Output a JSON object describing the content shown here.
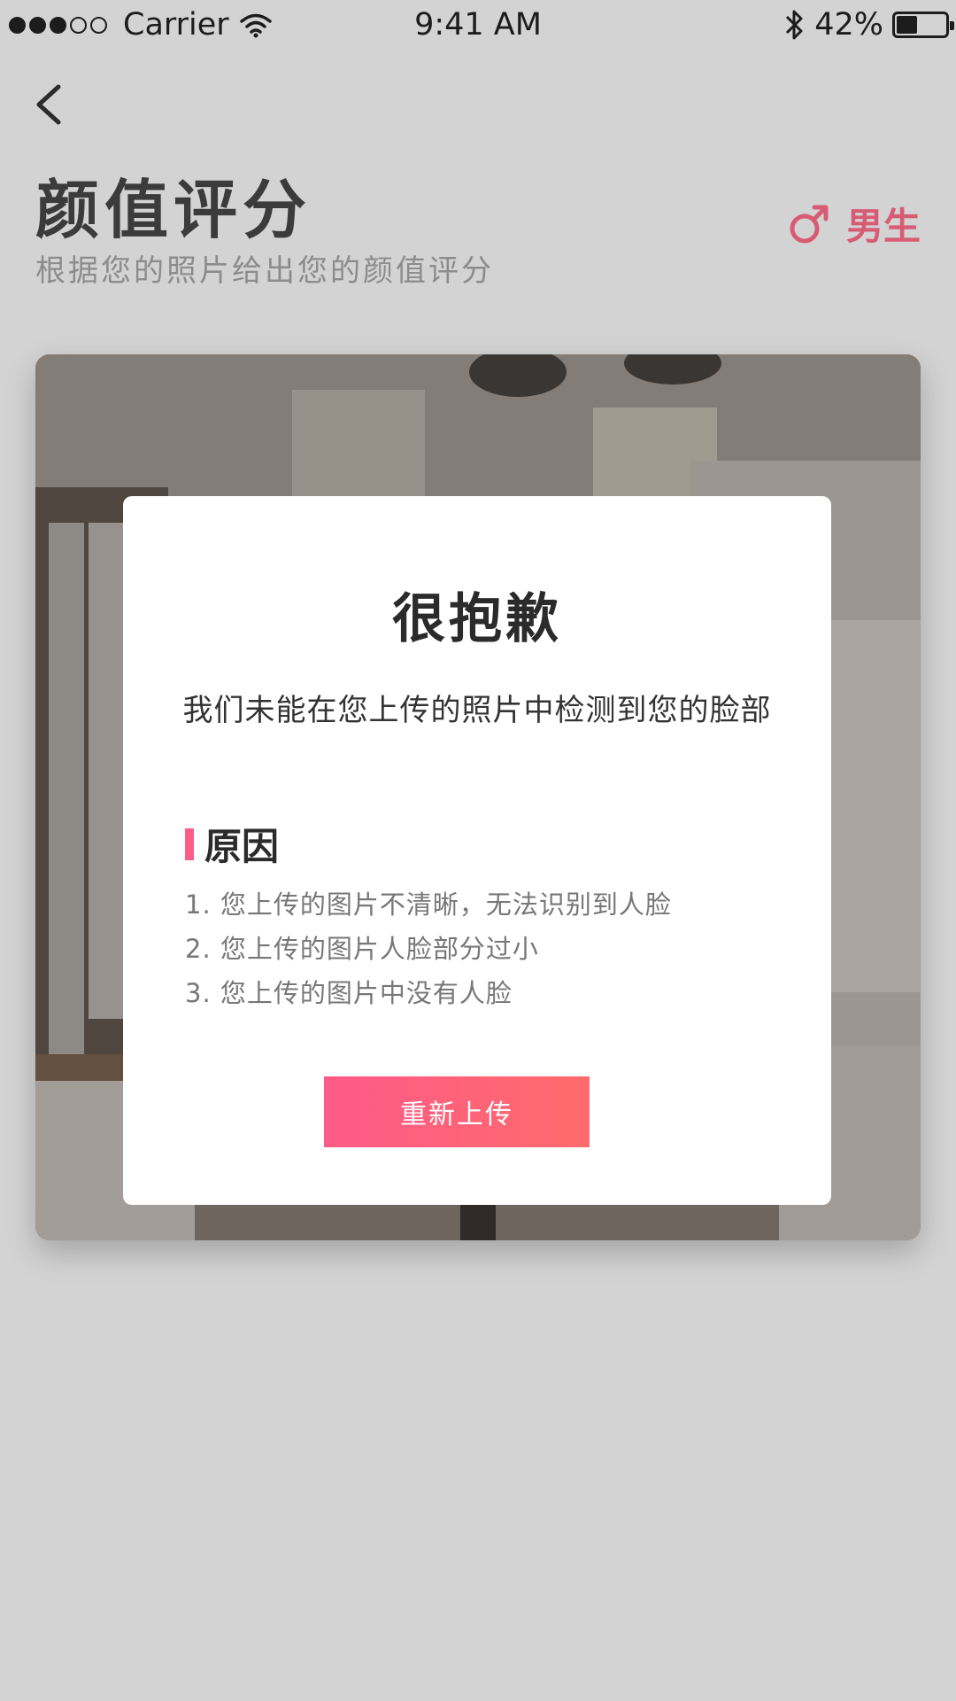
{
  "status_bar": {
    "carrier": "Carrier",
    "time": "9:41 AM",
    "battery": "42%",
    "battery_level": 0.42,
    "icons": [
      "signal-dots-icon",
      "wifi-icon",
      "bluetooth-icon",
      "battery-icon"
    ]
  },
  "header": {
    "back_icon": "chevron-left-icon",
    "title": "颜值评分",
    "subtitle": "根据您的照片给出您的颜值评分",
    "gender_icon": "male-icon",
    "gender_label": "男生"
  },
  "dialog": {
    "title": "很抱歉",
    "message": "我们未能在您上传的照片中检测到您的脸部",
    "reason_heading": "原因",
    "reasons": [
      "1. 您上传的图片不清晰，无法识别到人脸",
      "2. 您上传的图片人脸部分过小",
      "3. 您上传的图片中没有人脸"
    ],
    "button_label": "重新上传"
  },
  "colors": {
    "accent": "#fe5a88",
    "accent_end": "#ff6b6b",
    "gender": "#d75c73",
    "background": "#d3d3d4"
  }
}
